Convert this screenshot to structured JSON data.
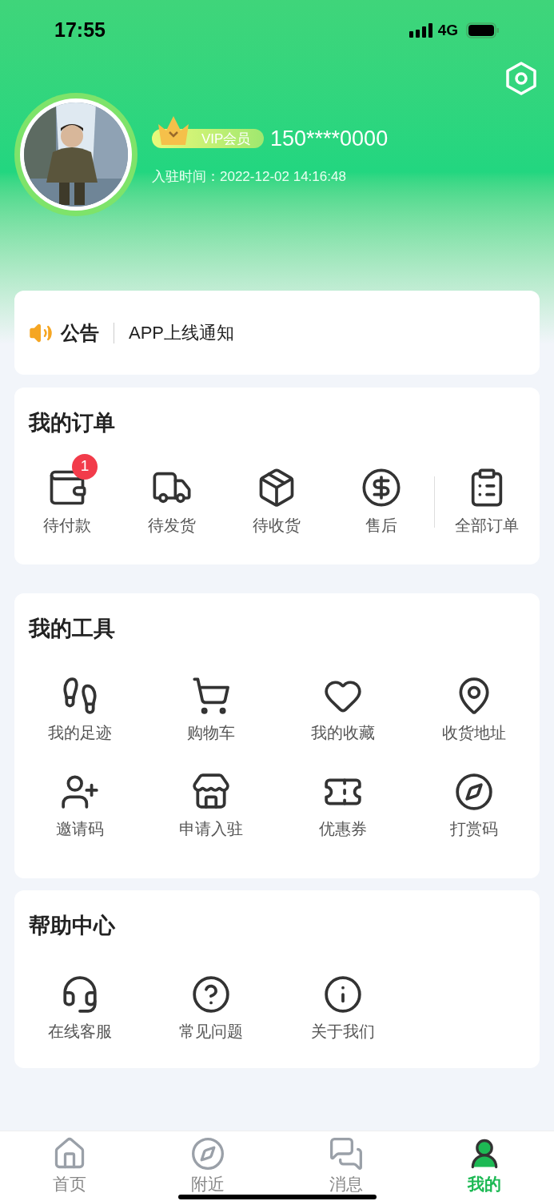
{
  "status_bar": {
    "time": "17:55",
    "network": "4G"
  },
  "profile": {
    "vip_label": "VIP会员",
    "phone": "150****0000",
    "joined": "入驻时间：2022-12-02 14:16:48"
  },
  "notice": {
    "label": "公告",
    "text": "APP上线通知"
  },
  "orders": {
    "title": "我的订单",
    "items": [
      {
        "label": "待付款",
        "badge": "1"
      },
      {
        "label": "待发货"
      },
      {
        "label": "待收货"
      },
      {
        "label": "售后"
      },
      {
        "label": "全部订单"
      }
    ]
  },
  "tools": {
    "title": "我的工具",
    "items": [
      "我的足迹",
      "购物车",
      "我的收藏",
      "收货地址",
      "邀请码",
      "申请入驻",
      "优惠券",
      "打赏码"
    ]
  },
  "help": {
    "title": "帮助中心",
    "items": [
      "在线客服",
      "常见问题",
      "关于我们"
    ]
  },
  "tab_bar": [
    {
      "label": "首页",
      "selected": false
    },
    {
      "label": "附近",
      "selected": false
    },
    {
      "label": "消息",
      "selected": false
    },
    {
      "label": "我的",
      "selected": true
    }
  ]
}
